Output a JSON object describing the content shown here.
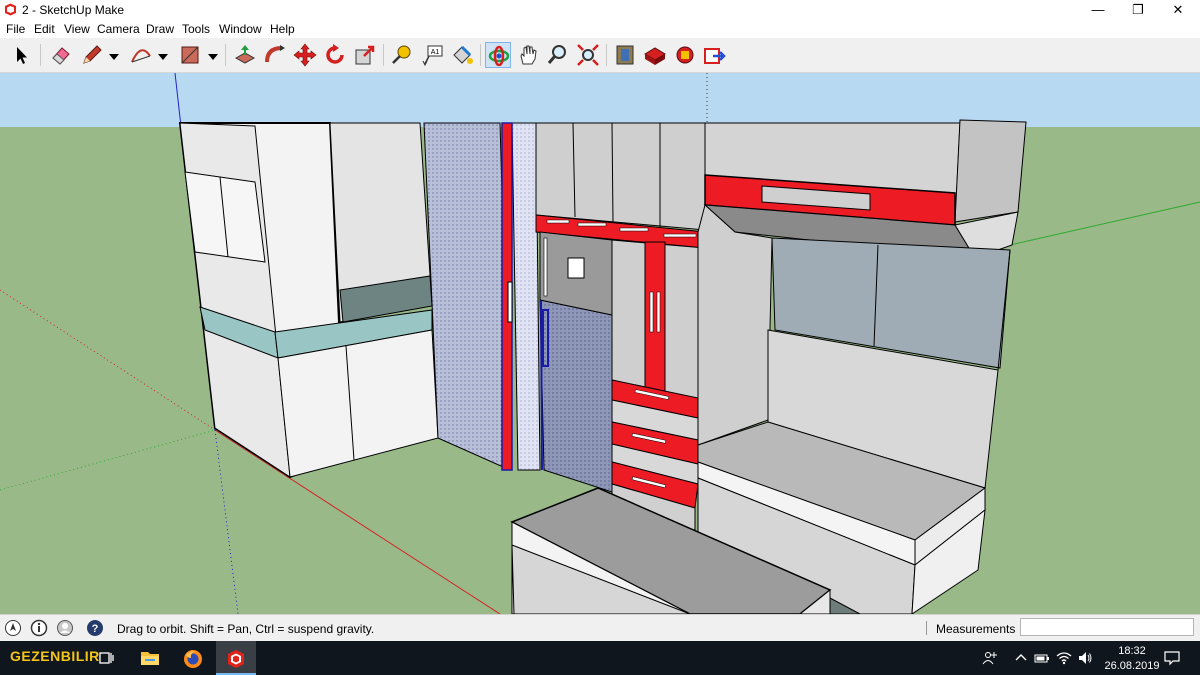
{
  "window": {
    "title": "2 - SketchUp Make",
    "minimize_glyph": "—",
    "restore_glyph": "❐",
    "close_glyph": "✕"
  },
  "menu": [
    "File",
    "Edit",
    "View",
    "Camera",
    "Draw",
    "Tools",
    "Window",
    "Help"
  ],
  "toolbar": {
    "tools": [
      {
        "name": "select-tool",
        "icon": "arrow-cursor-icon"
      },
      {
        "name": "eraser-tool",
        "icon": "eraser-icon"
      },
      {
        "name": "line-tool",
        "icon": "pencil-icon"
      },
      {
        "name": "arc-tool",
        "icon": "arc-icon"
      },
      {
        "name": "shape-tool",
        "icon": "rectangle-icon"
      },
      {
        "name": "push-pull-tool",
        "icon": "push-pull-icon"
      },
      {
        "name": "follow-me-tool",
        "icon": "follow-me-icon"
      },
      {
        "name": "move-tool",
        "icon": "move-icon"
      },
      {
        "name": "rotate-tool",
        "icon": "rotate-icon"
      },
      {
        "name": "scale-tool",
        "icon": "scale-icon"
      },
      {
        "name": "tape-measure-tool",
        "icon": "tape-measure-icon"
      },
      {
        "name": "text-tool",
        "icon": "text-icon"
      },
      {
        "name": "paint-bucket-tool",
        "icon": "paint-bucket-icon"
      },
      {
        "name": "orbit-tool",
        "icon": "orbit-icon",
        "active": true
      },
      {
        "name": "pan-tool",
        "icon": "hand-icon"
      },
      {
        "name": "zoom-tool",
        "icon": "magnifier-icon"
      },
      {
        "name": "zoom-extents-tool",
        "icon": "zoom-extents-icon"
      },
      {
        "name": "3d-warehouse-tool",
        "icon": "warehouse-icon"
      },
      {
        "name": "extension-warehouse-tool",
        "icon": "extension-warehouse-icon"
      },
      {
        "name": "layout-send-tool",
        "icon": "layout-icon"
      },
      {
        "name": "share-model-tool",
        "icon": "share-model-icon"
      }
    ],
    "text_tool_label": "A1"
  },
  "viewport": {
    "sky_color": "#b8d9f2",
    "ground_color": "#99b989",
    "accent_red": "#ed1c24",
    "axis_red": "#d62020",
    "axis_green": "#2ea82e",
    "axis_blue": "#2222cc"
  },
  "status": {
    "hint": "Drag to orbit. Shift = Pan, Ctrl = suspend gravity.",
    "measurements_label": "Measurements",
    "measurements_value": ""
  },
  "taskbar": {
    "brand": "GEZENBILIR",
    "apps": [
      {
        "name": "task-view",
        "icon": "task-view-icon"
      },
      {
        "name": "file-explorer",
        "icon": "folder-icon"
      },
      {
        "name": "firefox",
        "icon": "firefox-icon"
      },
      {
        "name": "sketchup",
        "icon": "sketchup-icon",
        "active": true
      }
    ],
    "time": "18:32",
    "date": "26.08.2019"
  }
}
